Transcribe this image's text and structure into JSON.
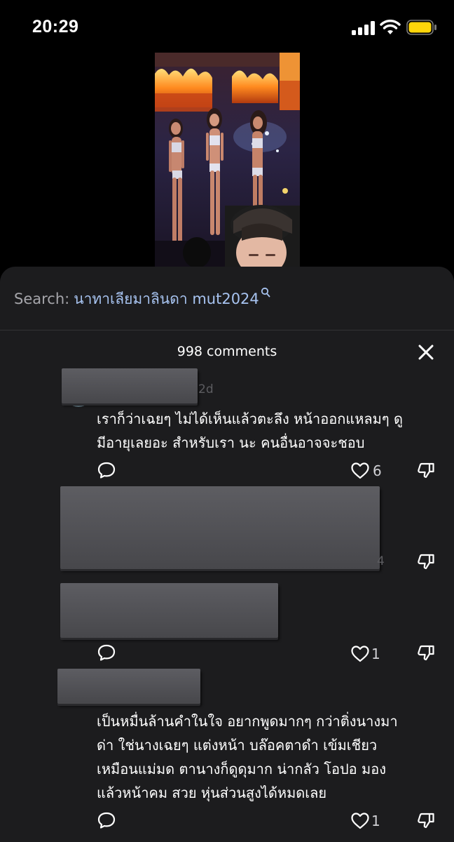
{
  "status_bar": {
    "time": "20:29",
    "icons": [
      "cellular-signal-icon",
      "wifi-icon",
      "battery-icon"
    ],
    "battery_color": "#FFD60A"
  },
  "video": {
    "description_icon": "video-thumbnail"
  },
  "search": {
    "prefix": "Search:",
    "query": "นาทาเลียมาลินดา mut2024",
    "icon": "search-icon"
  },
  "comments": {
    "count_label": "998 comments",
    "close_icon": "close-icon",
    "items": [
      {
        "date": "2d",
        "text_lines": [
          "เราก็ว่าเฉยๆ ไม่ได้เห็นแล้วตะลึง หน้าออกแหลมๆ ดู",
          "มีอายุเลยอะ สำหรับเรา นะ คนอื่นอาจจะชอบ"
        ],
        "likes": "6"
      },
      {
        "partial": "4"
      },
      {
        "likes": "1"
      },
      {
        "text_lines": [
          "เป็นหมื่นล้านคำในใจ อยากพูดมากๆ กว่าติ่งนางมา",
          "ด่า ใช่นางเฉยๆ แต่งหน้า บล๊อคตาดำ เข้มเชียว",
          "เหมือนแม่มด ตานางก็ดูดุมาก น่ากลัว โอปอ มอง",
          "แล้วหน้าคม สวย หุ่นส่วนสูงได้หมดเลย"
        ],
        "likes": "1"
      }
    ]
  },
  "colors": {
    "sheet_bg": "#1C1C1E",
    "link": "#A7C3F0",
    "muted": "#A5A5AA"
  }
}
